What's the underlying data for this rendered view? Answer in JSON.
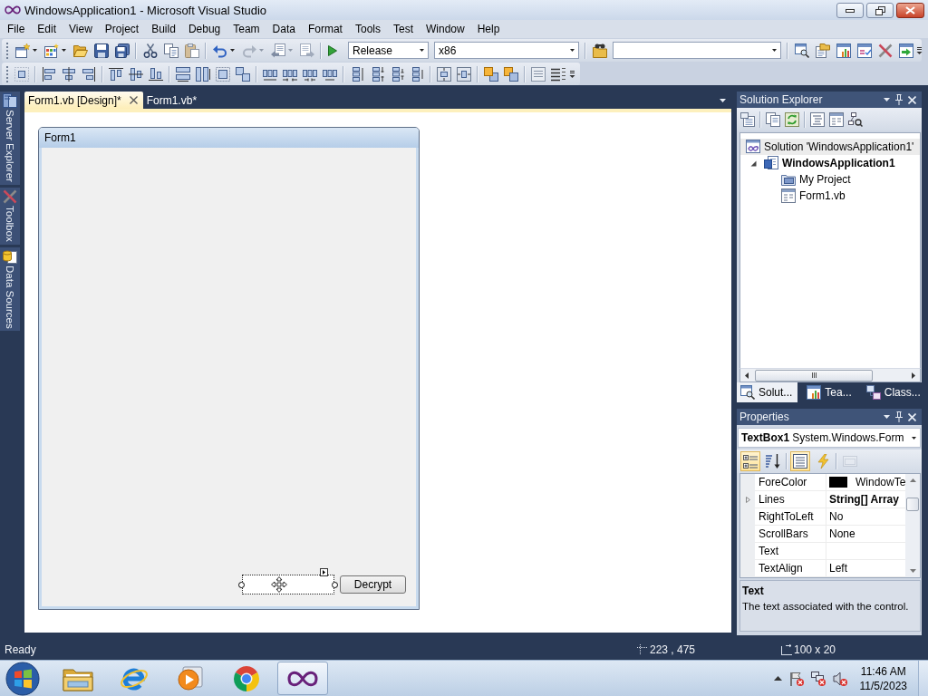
{
  "window": {
    "title": "WindowsApplication1 - Microsoft Visual Studio"
  },
  "menu": [
    "File",
    "Edit",
    "View",
    "Project",
    "Build",
    "Debug",
    "Team",
    "Data",
    "Format",
    "Tools",
    "Test",
    "Window",
    "Help"
  ],
  "toolbar": {
    "configuration": "Release",
    "platform": "x86"
  },
  "side_tabs": [
    {
      "label": "Server Explorer",
      "kind": "server"
    },
    {
      "label": "Toolbox",
      "kind": "toolbox"
    },
    {
      "label": "Data Sources",
      "kind": "data"
    }
  ],
  "document_tabs": [
    {
      "label": "Form1.vb [Design]*",
      "selected": true
    },
    {
      "label": "Form1.vb*",
      "selected": false
    }
  ],
  "designer": {
    "form_title": "Form1",
    "controls": [
      {
        "kind": "textbox",
        "selected": true
      },
      {
        "kind": "button",
        "label": "Decrypt",
        "selected": false
      }
    ]
  },
  "solution_explorer": {
    "title": "Solution Explorer",
    "tree": [
      {
        "label": "Solution 'WindowsApplication1'",
        "kind": "solution",
        "selected": true,
        "startup": false,
        "children": [
          {
            "label": "WindowsApplication1",
            "kind": "project",
            "selected": false,
            "startup": true,
            "expanded": true,
            "children": [
              {
                "label": "My Project",
                "kind": "settings",
                "selected": false,
                "startup": false
              },
              {
                "label": "Form1.vb",
                "kind": "form",
                "selected": false,
                "startup": false
              }
            ]
          }
        ]
      }
    ],
    "tabs": [
      {
        "label": "Solut...",
        "kind": "solution",
        "selected": true
      },
      {
        "label": "Tea...",
        "kind": "team",
        "selected": false
      },
      {
        "label": "Class...",
        "kind": "class",
        "selected": false
      }
    ]
  },
  "properties": {
    "title": "Properties",
    "object_name": "TextBox1",
    "object_type": "System.Windows.Form",
    "tool_buttons": [
      {
        "kind": "categorized",
        "selected": true,
        "disabled": false
      },
      {
        "kind": "alphabetical",
        "selected": false,
        "disabled": false
      },
      {
        "kind": "properties",
        "selected": true,
        "disabled": false
      },
      {
        "kind": "events",
        "selected": false,
        "disabled": false
      },
      {
        "kind": "pages",
        "selected": false,
        "disabled": true
      }
    ],
    "rows": [
      {
        "name": "ForeColor",
        "value": "WindowTe",
        "color": "#000000",
        "modified": false
      },
      {
        "name": "Lines",
        "value": "String[] Array",
        "expanded": false,
        "modified": true
      },
      {
        "name": "RightToLeft",
        "value": "No",
        "modified": false
      },
      {
        "name": "ScrollBars",
        "value": "None",
        "modified": false
      },
      {
        "name": "Text"
      },
      {
        "name": "TextAlign",
        "value": "Left",
        "modified": false
      }
    ],
    "description": {
      "title": "Text",
      "text": "The text associated with the control."
    }
  },
  "status_bar": {
    "text": "Ready",
    "position": "223 , 475",
    "size": "100 x 20"
  },
  "taskbar": {
    "apps": [
      {
        "kind": "explorer",
        "selected": false
      },
      {
        "kind": "browser",
        "selected": false
      },
      {
        "kind": "media",
        "selected": false
      },
      {
        "kind": "chrome",
        "selected": false
      },
      {
        "kind": "studio",
        "selected": true
      }
    ],
    "clock": {
      "time": "11:46 AM",
      "date": "11/5/2023"
    }
  }
}
